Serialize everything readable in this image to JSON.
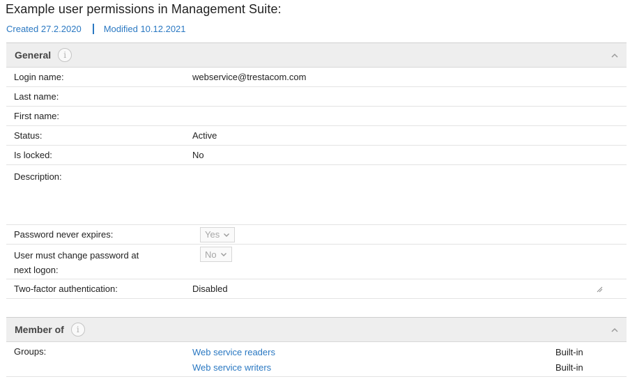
{
  "caption": "Example user permissions in Management Suite:",
  "meta": {
    "created": "Created 27.2.2020",
    "modified": "Modified 10.12.2021"
  },
  "general": {
    "title": "General",
    "info_icon": "i",
    "fields": {
      "login_name": {
        "label": "Login name:",
        "value": "webservice@trestacom.com"
      },
      "last_name": {
        "label": "Last name:",
        "value": ""
      },
      "first_name": {
        "label": "First name:",
        "value": ""
      },
      "status": {
        "label": "Status:",
        "value": "Active"
      },
      "is_locked": {
        "label": "Is locked:",
        "value": "No"
      },
      "description": {
        "label": "Description:",
        "value": ""
      },
      "password_never_expires": {
        "label": "Password never expires:",
        "value": "Yes"
      },
      "must_change_password": {
        "label": "User must change password at next logon:",
        "value": "No"
      },
      "two_factor": {
        "label": "Two-factor authentication:",
        "value": "Disabled"
      }
    }
  },
  "member_of": {
    "title": "Member of",
    "info_icon": "i",
    "groups_label": "Groups:",
    "groups": [
      {
        "name": "Web service readers",
        "type": "Built-in"
      },
      {
        "name": "Web service writers",
        "type": "Built-in"
      }
    ]
  },
  "colors": {
    "link": "#2a78c2",
    "panel_header_bg": "#eeeeee"
  },
  "icons": [
    "info-icon",
    "chevron-up-icon",
    "chevron-down-icon",
    "resize-grip-icon"
  ]
}
